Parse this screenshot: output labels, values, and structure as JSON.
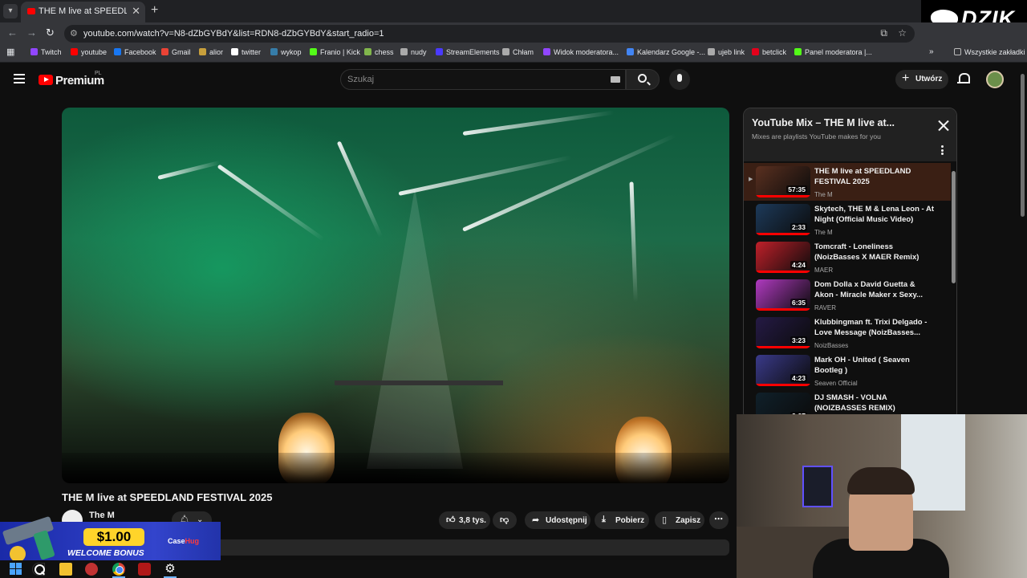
{
  "browser": {
    "tab_title": "THE M live at SPEEDLAND F",
    "url": "youtube.com/watch?v=N8-dZbGYBdY&list=RDN8-dZbGYBdY&start_radio=1",
    "bookmarks": [
      {
        "label": "Twitch",
        "color": "#9146ff"
      },
      {
        "label": "youtube",
        "color": "#ff0000"
      },
      {
        "label": "Facebook",
        "color": "#1877f2"
      },
      {
        "label": "Gmail",
        "color": "#ea4335"
      },
      {
        "label": "alior",
        "color": "#c8a03c"
      },
      {
        "label": "twitter",
        "color": "#ffffff"
      },
      {
        "label": "wykop",
        "color": "#367da9"
      },
      {
        "label": "Franio | Kick",
        "color": "#53fc18"
      },
      {
        "label": "chess",
        "color": "#81b64c"
      },
      {
        "label": "nudy",
        "color": "#aaaaaa"
      },
      {
        "label": "StreamElements",
        "color": "#4a3aff"
      },
      {
        "label": "Chłam",
        "color": "#aaaaaa"
      },
      {
        "label": "Widok moderatora...",
        "color": "#9146ff"
      },
      {
        "label": "Kalendarz Google -...",
        "color": "#4285f4"
      },
      {
        "label": "ujeb link",
        "color": "#aaaaaa"
      },
      {
        "label": "betclick",
        "color": "#e3001b"
      },
      {
        "label": "Panel moderatora |...",
        "color": "#53fc18"
      }
    ],
    "all_bookmarks": "Wszystkie zakładki"
  },
  "overlay_logo": "DZIK",
  "youtube": {
    "logo_text": "Premium",
    "region": "PL",
    "search_placeholder": "Szukaj",
    "create_label": "Utwórz"
  },
  "video": {
    "title": "THE M live at SPEEDLAND FESTIVAL 2025",
    "channel": "The M",
    "likes": "3,8 tys.",
    "share_label": "Udostępnij",
    "download_label": "Pobierz",
    "save_label": "Zapisz"
  },
  "playlist": {
    "title": "YouTube Mix – THE M live at...",
    "subtitle": "Mixes are playlists YouTube makes for you",
    "items": [
      {
        "title": "THE M live at SPEEDLAND FESTIVAL 2025",
        "channel": "The M",
        "duration": "57:35",
        "active": true,
        "thumb": "#5a3020"
      },
      {
        "title": "Skytech, THE M & Lena Leon - At Night (Official Music Video)",
        "channel": "The M",
        "duration": "2:33",
        "active": false,
        "thumb": "#1d3a5a"
      },
      {
        "title": "Tomcraft - Loneliness (NoizBasses X MAER Remix)",
        "channel": "MAER",
        "duration": "4:24",
        "active": false,
        "thumb": "#c0202a"
      },
      {
        "title": "Dom Dolla x David Guetta & Akon - Miracle Maker x Sexy...",
        "channel": "RAVER",
        "duration": "6:35",
        "active": false,
        "thumb": "#b03ac0"
      },
      {
        "title": "Klubbingman ft. Trixi Delgado - Love Message (NoizBasses...",
        "channel": "NoizBasses",
        "duration": "3:23",
        "active": false,
        "thumb": "#251a45"
      },
      {
        "title": "Mark OH - United ( Seaven Bootleg )",
        "channel": "Seaven Official",
        "duration": "4:23",
        "active": false,
        "thumb": "#3a3a8a"
      },
      {
        "title": "DJ SMASH - VOLNA (NOIZBASSES REMIX)",
        "channel": "",
        "duration": "3:27",
        "active": false,
        "thumb": "#10202a"
      }
    ]
  },
  "promo": {
    "amount": "$1.00",
    "text": "WELCOME BONUS",
    "brand_a": "Case",
    "brand_b": "Hug"
  }
}
